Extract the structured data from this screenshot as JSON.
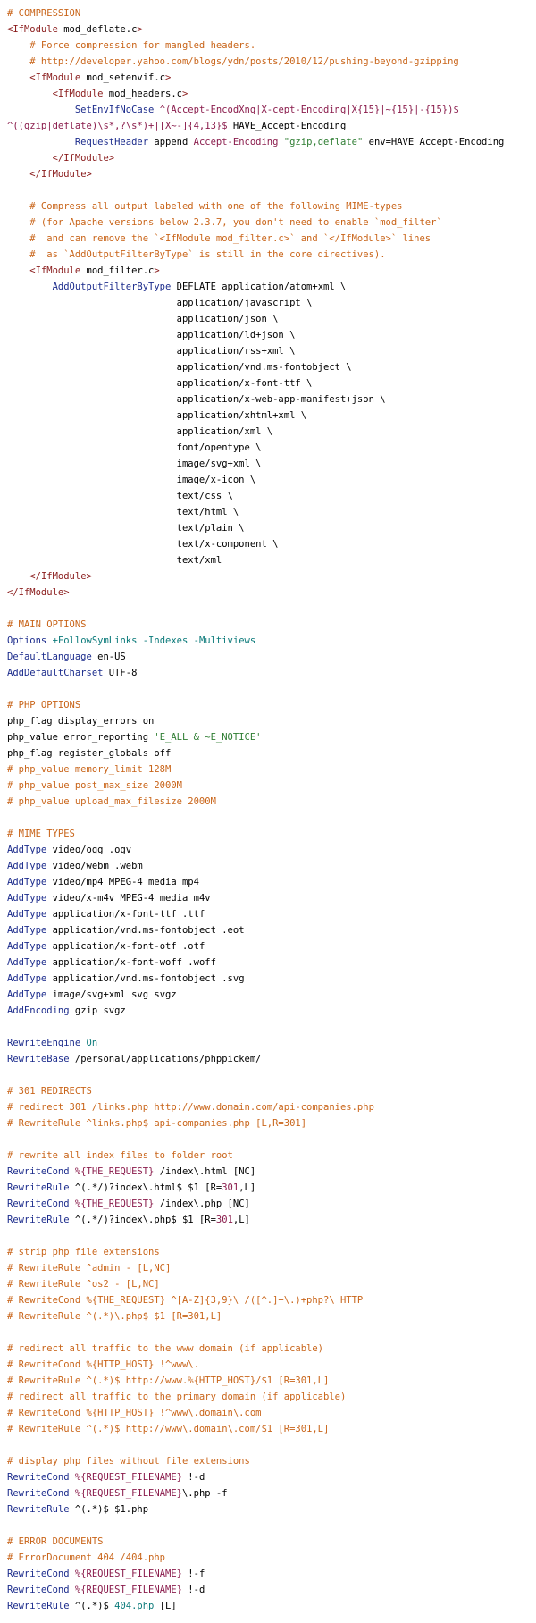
{
  "document": {
    "lines": [
      [
        {
          "t": "# COMPRESSION",
          "c": "cm"
        }
      ],
      [
        {
          "t": "<IfModule",
          "c": "tg"
        },
        {
          "t": " mod_deflate.c",
          "c": "tx"
        },
        {
          "t": ">",
          "c": "tg"
        }
      ],
      [
        {
          "t": "    # Force compression for mangled headers.",
          "c": "cm"
        }
      ],
      [
        {
          "t": "    # http://developer.yahoo.com/blogs/ydn/posts/2010/12/pushing-beyond-gzipping",
          "c": "cm"
        }
      ],
      [
        {
          "t": "    ",
          "c": "tx"
        },
        {
          "t": "<IfModule",
          "c": "tg"
        },
        {
          "t": " mod_setenvif.c",
          "c": "tx"
        },
        {
          "t": ">",
          "c": "tg"
        }
      ],
      [
        {
          "t": "        ",
          "c": "tx"
        },
        {
          "t": "<IfModule",
          "c": "tg"
        },
        {
          "t": " mod_headers.c",
          "c": "tx"
        },
        {
          "t": ">",
          "c": "tg"
        }
      ],
      [
        {
          "t": "            ",
          "c": "tx"
        },
        {
          "t": "SetEnvIfNoCase",
          "c": "kw"
        },
        {
          "t": " ^(Accept-EncodXng|X-cept-Encoding|X{15}|~{15}|-{15})$",
          "c": "va"
        }
      ],
      [
        {
          "t": "^((gzip|deflate)\\s*,?\\s*)+|[X~-]{4,13}$",
          "c": "va"
        },
        {
          "t": " HAVE_Accept-Encoding",
          "c": "tx"
        }
      ],
      [
        {
          "t": "            ",
          "c": "tx"
        },
        {
          "t": "RequestHeader",
          "c": "kw"
        },
        {
          "t": " append ",
          "c": "tx"
        },
        {
          "t": "Accept-Encoding",
          "c": "va"
        },
        {
          "t": " ",
          "c": "tx"
        },
        {
          "t": "\"gzip,deflate\"",
          "c": "st"
        },
        {
          "t": " env=HAVE_Accept-Encoding",
          "c": "tx"
        }
      ],
      [
        {
          "t": "        ",
          "c": "tx"
        },
        {
          "t": "</IfModule>",
          "c": "tg"
        }
      ],
      [
        {
          "t": "    ",
          "c": "tx"
        },
        {
          "t": "</IfModule>",
          "c": "tg"
        }
      ],
      [
        {
          "t": "",
          "c": "tx"
        }
      ],
      [
        {
          "t": "    # Compress all output labeled with one of the following MIME-types",
          "c": "cm"
        }
      ],
      [
        {
          "t": "    # (for Apache versions below 2.3.7, you don't need to enable `mod_filter`",
          "c": "cm"
        }
      ],
      [
        {
          "t": "    #  and can remove the `<IfModule mod_filter.c>` and `</IfModule>` lines",
          "c": "cm"
        }
      ],
      [
        {
          "t": "    #  as `AddOutputFilterByType` is still in the core directives).",
          "c": "cm"
        }
      ],
      [
        {
          "t": "    ",
          "c": "tx"
        },
        {
          "t": "<IfModule",
          "c": "tg"
        },
        {
          "t": " mod_filter.c",
          "c": "tx"
        },
        {
          "t": ">",
          "c": "tg"
        }
      ],
      [
        {
          "t": "        ",
          "c": "tx"
        },
        {
          "t": "AddOutputFilterByType",
          "c": "kw"
        },
        {
          "t": " DEFLATE application/atom+xml \\",
          "c": "tx"
        }
      ],
      [
        {
          "t": "                              application/javascript \\",
          "c": "tx"
        }
      ],
      [
        {
          "t": "                              application/json \\",
          "c": "tx"
        }
      ],
      [
        {
          "t": "                              application/ld+json \\",
          "c": "tx"
        }
      ],
      [
        {
          "t": "                              application/rss+xml \\",
          "c": "tx"
        }
      ],
      [
        {
          "t": "                              application/vnd.ms-fontobject \\",
          "c": "tx"
        }
      ],
      [
        {
          "t": "                              application/x-font-ttf \\",
          "c": "tx"
        }
      ],
      [
        {
          "t": "                              application/x-web-app-manifest+json \\",
          "c": "tx"
        }
      ],
      [
        {
          "t": "                              application/xhtml+xml \\",
          "c": "tx"
        }
      ],
      [
        {
          "t": "                              application/xml \\",
          "c": "tx"
        }
      ],
      [
        {
          "t": "                              font/opentype \\",
          "c": "tx"
        }
      ],
      [
        {
          "t": "                              image/svg+xml \\",
          "c": "tx"
        }
      ],
      [
        {
          "t": "                              image/x-icon \\",
          "c": "tx"
        }
      ],
      [
        {
          "t": "                              text/css \\",
          "c": "tx"
        }
      ],
      [
        {
          "t": "                              text/html \\",
          "c": "tx"
        }
      ],
      [
        {
          "t": "                              text/plain \\",
          "c": "tx"
        }
      ],
      [
        {
          "t": "                              text/x-component \\",
          "c": "tx"
        }
      ],
      [
        {
          "t": "                              text/xml",
          "c": "tx"
        }
      ],
      [
        {
          "t": "    ",
          "c": "tx"
        },
        {
          "t": "</IfModule>",
          "c": "tg"
        }
      ],
      [
        {
          "t": "</IfModule>",
          "c": "tg"
        }
      ],
      [
        {
          "t": "",
          "c": "tx"
        }
      ],
      [
        {
          "t": "# MAIN OPTIONS",
          "c": "cm"
        }
      ],
      [
        {
          "t": "Options",
          "c": "kw"
        },
        {
          "t": " +FollowSymLinks -Indexes -Multiviews",
          "c": "ac"
        }
      ],
      [
        {
          "t": "DefaultLanguage",
          "c": "kw"
        },
        {
          "t": " en-US",
          "c": "tx"
        }
      ],
      [
        {
          "t": "AddDefaultCharset",
          "c": "kw"
        },
        {
          "t": " UTF-8",
          "c": "tx"
        }
      ],
      [
        {
          "t": "",
          "c": "tx"
        }
      ],
      [
        {
          "t": "# PHP OPTIONS",
          "c": "cm"
        }
      ],
      [
        {
          "t": "php_flag display_errors on",
          "c": "tx"
        }
      ],
      [
        {
          "t": "php_value error_reporting ",
          "c": "tx"
        },
        {
          "t": "'E_ALL & ~E_NOTICE'",
          "c": "st"
        }
      ],
      [
        {
          "t": "php_flag register_globals off",
          "c": "tx"
        }
      ],
      [
        {
          "t": "# php_value memory_limit 128M",
          "c": "cm"
        }
      ],
      [
        {
          "t": "# php_value post_max_size 2000M",
          "c": "cm"
        }
      ],
      [
        {
          "t": "# php_value upload_max_filesize 2000M",
          "c": "cm"
        }
      ],
      [
        {
          "t": "",
          "c": "tx"
        }
      ],
      [
        {
          "t": "# MIME TYPES",
          "c": "cm"
        }
      ],
      [
        {
          "t": "AddType",
          "c": "kw"
        },
        {
          "t": " video/ogg .ogv",
          "c": "tx"
        }
      ],
      [
        {
          "t": "AddType",
          "c": "kw"
        },
        {
          "t": " video/webm .webm",
          "c": "tx"
        }
      ],
      [
        {
          "t": "AddType",
          "c": "kw"
        },
        {
          "t": " video/mp4 MPEG-4 media mp4",
          "c": "tx"
        }
      ],
      [
        {
          "t": "AddType",
          "c": "kw"
        },
        {
          "t": " video/x-m4v MPEG-4 media m4v",
          "c": "tx"
        }
      ],
      [
        {
          "t": "AddType",
          "c": "kw"
        },
        {
          "t": " application/x-font-ttf .ttf",
          "c": "tx"
        }
      ],
      [
        {
          "t": "AddType",
          "c": "kw"
        },
        {
          "t": " application/vnd.ms-fontobject .eot",
          "c": "tx"
        }
      ],
      [
        {
          "t": "AddType",
          "c": "kw"
        },
        {
          "t": " application/x-font-otf .otf",
          "c": "tx"
        }
      ],
      [
        {
          "t": "AddType",
          "c": "kw"
        },
        {
          "t": " application/x-font-woff .woff",
          "c": "tx"
        }
      ],
      [
        {
          "t": "AddType",
          "c": "kw"
        },
        {
          "t": " application/vnd.ms-fontobject .svg",
          "c": "tx"
        }
      ],
      [
        {
          "t": "AddType",
          "c": "kw"
        },
        {
          "t": " image/svg+xml svg svgz",
          "c": "tx"
        }
      ],
      [
        {
          "t": "AddEncoding",
          "c": "kw"
        },
        {
          "t": " gzip svgz",
          "c": "tx"
        }
      ],
      [
        {
          "t": "",
          "c": "tx"
        }
      ],
      [
        {
          "t": "RewriteEngine",
          "c": "kw"
        },
        {
          "t": " On",
          "c": "ac"
        }
      ],
      [
        {
          "t": "RewriteBase",
          "c": "kw"
        },
        {
          "t": " /personal/applications/phppickem/",
          "c": "tx"
        }
      ],
      [
        {
          "t": "",
          "c": "tx"
        }
      ],
      [
        {
          "t": "# 301 REDIRECTS",
          "c": "cm"
        }
      ],
      [
        {
          "t": "# redirect 301 /links.php http://www.domain.com/api-companies.php",
          "c": "cm"
        }
      ],
      [
        {
          "t": "# RewriteRule ^links.php$ api-companies.php [L,R=301]",
          "c": "cm"
        }
      ],
      [
        {
          "t": "",
          "c": "tx"
        }
      ],
      [
        {
          "t": "# rewrite all index files to folder root",
          "c": "cm"
        }
      ],
      [
        {
          "t": "RewriteCond",
          "c": "kw"
        },
        {
          "t": " %{THE_REQUEST}",
          "c": "va"
        },
        {
          "t": " /index\\.html [NC]",
          "c": "tx"
        }
      ],
      [
        {
          "t": "RewriteRule",
          "c": "kw"
        },
        {
          "t": " ^(.*/)?index\\.html$ $1 [R=",
          "c": "tx"
        },
        {
          "t": "301",
          "c": "va"
        },
        {
          "t": ",L]",
          "c": "tx"
        }
      ],
      [
        {
          "t": "RewriteCond",
          "c": "kw"
        },
        {
          "t": " %{THE_REQUEST}",
          "c": "va"
        },
        {
          "t": " /index\\.php [NC]",
          "c": "tx"
        }
      ],
      [
        {
          "t": "RewriteRule",
          "c": "kw"
        },
        {
          "t": " ^(.*/)?index\\.php$ $1 [R=",
          "c": "tx"
        },
        {
          "t": "301",
          "c": "va"
        },
        {
          "t": ",L]",
          "c": "tx"
        }
      ],
      [
        {
          "t": "",
          "c": "tx"
        }
      ],
      [
        {
          "t": "# strip php file extensions",
          "c": "cm"
        }
      ],
      [
        {
          "t": "# RewriteRule ^admin - [L,NC]",
          "c": "cm"
        }
      ],
      [
        {
          "t": "# RewriteRule ^os2 - [L,NC]",
          "c": "cm"
        }
      ],
      [
        {
          "t": "# RewriteCond %{THE_REQUEST} ^[A-Z]{3,9}\\ /([^.]+\\.)+php?\\ HTTP",
          "c": "cm"
        }
      ],
      [
        {
          "t": "# RewriteRule ^(.*)\\.php$ $1 [R=301,L]",
          "c": "cm"
        }
      ],
      [
        {
          "t": "",
          "c": "tx"
        }
      ],
      [
        {
          "t": "# redirect all traffic to the www domain (if applicable)",
          "c": "cm"
        }
      ],
      [
        {
          "t": "# RewriteCond %{HTTP_HOST} !^www\\.",
          "c": "cm"
        }
      ],
      [
        {
          "t": "# RewriteRule ^(.*)$ http://www.%{HTTP_HOST}/$1 [R=301,L]",
          "c": "cm"
        }
      ],
      [
        {
          "t": "# redirect all traffic to the primary domain (if applicable)",
          "c": "cm"
        }
      ],
      [
        {
          "t": "# RewriteCond %{HTTP_HOST} !^www\\.domain\\.com",
          "c": "cm"
        }
      ],
      [
        {
          "t": "# RewriteRule ^(.*)$ http://www\\.domain\\.com/$1 [R=301,L]",
          "c": "cm"
        }
      ],
      [
        {
          "t": "",
          "c": "tx"
        }
      ],
      [
        {
          "t": "# display php files without file extensions",
          "c": "cm"
        }
      ],
      [
        {
          "t": "RewriteCond",
          "c": "kw"
        },
        {
          "t": " %{REQUEST_FILENAME}",
          "c": "va"
        },
        {
          "t": " !-d",
          "c": "tx"
        }
      ],
      [
        {
          "t": "RewriteCond",
          "c": "kw"
        },
        {
          "t": " %{REQUEST_FILENAME}",
          "c": "va"
        },
        {
          "t": "\\.php -f",
          "c": "tx"
        }
      ],
      [
        {
          "t": "RewriteRule",
          "c": "kw"
        },
        {
          "t": " ^(.*)$ $1.php",
          "c": "tx"
        }
      ],
      [
        {
          "t": "",
          "c": "tx"
        }
      ],
      [
        {
          "t": "# ERROR DOCUMENTS",
          "c": "cm"
        }
      ],
      [
        {
          "t": "# ErrorDocument 404 /404.php",
          "c": "cm"
        }
      ],
      [
        {
          "t": "RewriteCond",
          "c": "kw"
        },
        {
          "t": " %{REQUEST_FILENAME}",
          "c": "va"
        },
        {
          "t": " !-f",
          "c": "tx"
        }
      ],
      [
        {
          "t": "RewriteCond",
          "c": "kw"
        },
        {
          "t": " %{REQUEST_FILENAME}",
          "c": "va"
        },
        {
          "t": " !-d",
          "c": "tx"
        }
      ],
      [
        {
          "t": "RewriteRule",
          "c": "kw"
        },
        {
          "t": " ^(.*)$ ",
          "c": "tx"
        },
        {
          "t": "404.php",
          "c": "ac"
        },
        {
          "t": " [L]",
          "c": "tx"
        }
      ]
    ]
  }
}
